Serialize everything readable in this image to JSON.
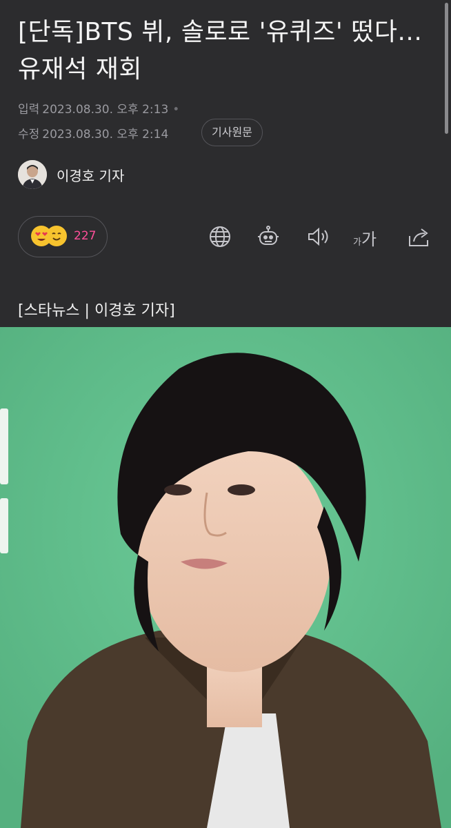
{
  "article": {
    "title": "[단독]BTS 뷔, 솔로로 '유퀴즈' 떴다...유재석 재회",
    "input_label": "입력",
    "input_time": "2023.08.30. 오후 2:13",
    "edit_label": "수정",
    "edit_time": "2023.08.30. 오후 2:14",
    "original_button": "기사원문",
    "author": "이경호 기자",
    "source_line": "[스타뉴스 | 이경호 기자]"
  },
  "reactions": {
    "count": "227"
  },
  "toolbar": {
    "font_small": "가",
    "font_large": "가",
    "icons": [
      "globe-icon",
      "robot-icon",
      "speaker-icon",
      "font-size-icon",
      "share-icon"
    ]
  },
  "colors": {
    "background": "#2c2c2e",
    "meta_text": "#9a9aa0",
    "reaction_count": "#ff4f9a",
    "photo_backdrop": "#5fbf8d"
  }
}
